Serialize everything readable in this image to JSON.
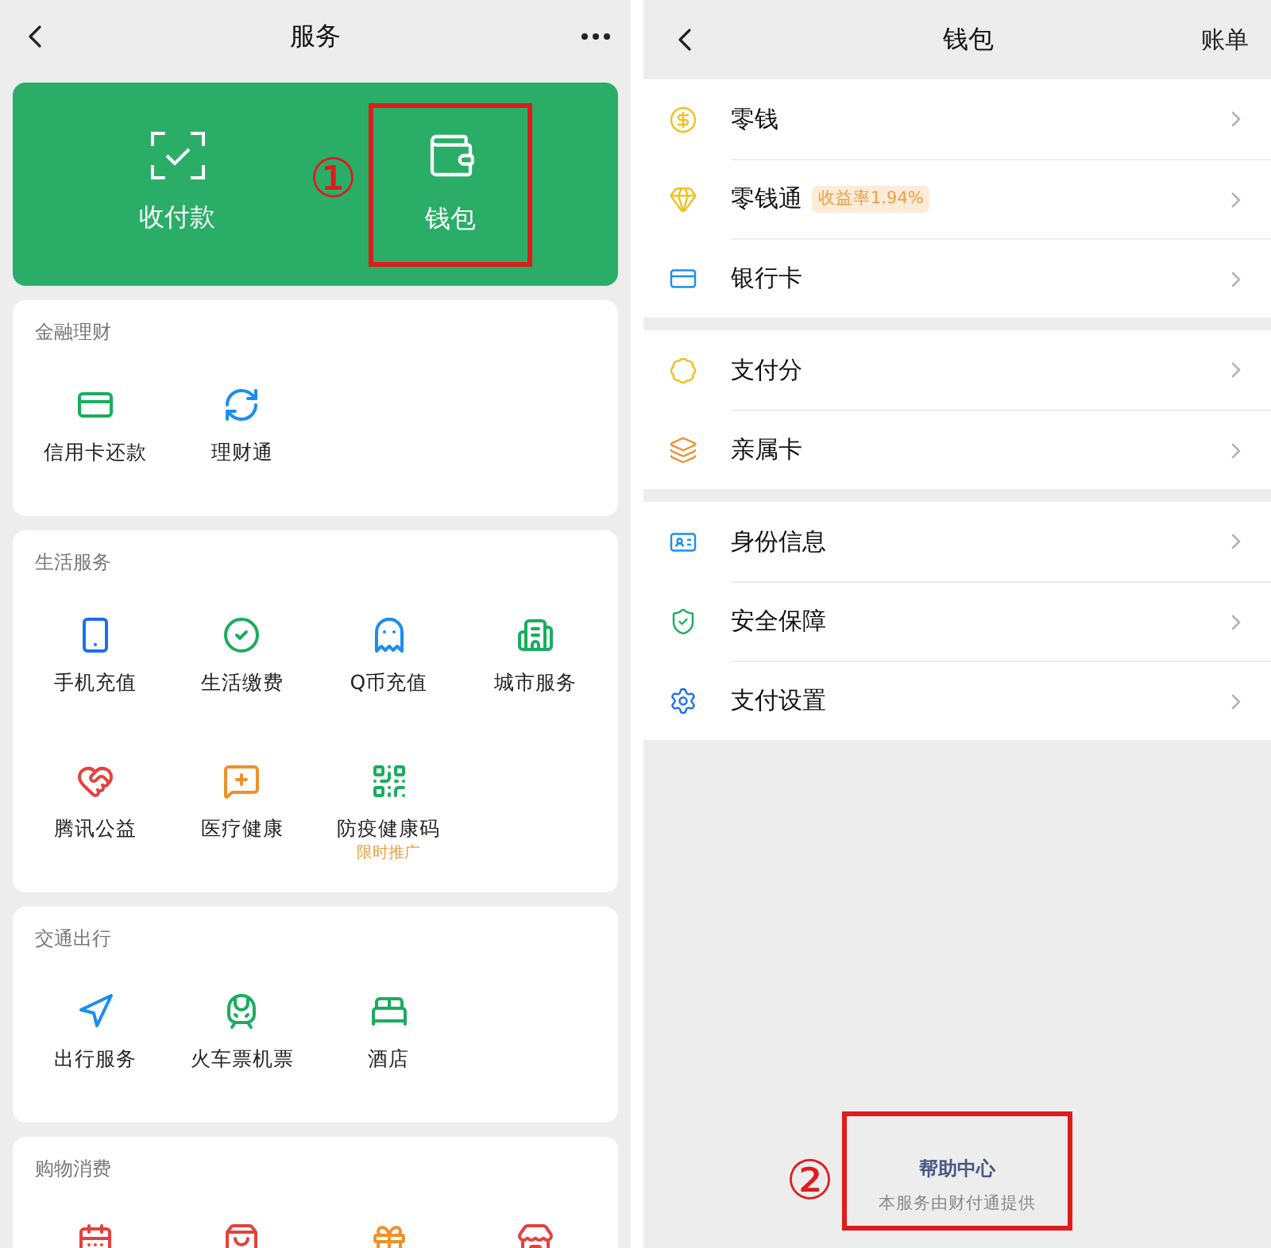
{
  "services_screen": {
    "title": "服务",
    "quick_actions": [
      {
        "label": "收付款",
        "highlighted": false
      },
      {
        "label": "钱包",
        "highlighted": true,
        "callout": "①"
      }
    ],
    "sections": [
      {
        "title": "金融理财",
        "items": [
          {
            "label": "信用卡还款"
          },
          {
            "label": "理财通"
          }
        ]
      },
      {
        "title": "生活服务",
        "items": [
          {
            "label": "手机充值"
          },
          {
            "label": "生活缴费"
          },
          {
            "label": "Q币充值"
          },
          {
            "label": "城市服务"
          },
          {
            "label": "腾讯公益"
          },
          {
            "label": "医疗健康"
          },
          {
            "label": "防疫健康码",
            "note": "限时推广"
          }
        ]
      },
      {
        "title": "交通出行",
        "items": [
          {
            "label": "出行服务"
          },
          {
            "label": "火车票机票"
          },
          {
            "label": "酒店"
          }
        ]
      },
      {
        "title": "购物消费"
      }
    ]
  },
  "wallet_screen": {
    "title": "钱包",
    "action": "账单",
    "groups": [
      {
        "items": [
          {
            "label": "零钱"
          },
          {
            "label": "零钱通",
            "badge": "收益率1.94%"
          },
          {
            "label": "银行卡"
          }
        ]
      },
      {
        "items": [
          {
            "label": "支付分"
          },
          {
            "label": "亲属卡"
          }
        ]
      },
      {
        "items": [
          {
            "label": "身份信息"
          },
          {
            "label": "安全保障"
          },
          {
            "label": "支付设置"
          }
        ]
      }
    ],
    "footer": {
      "link": "帮助中心",
      "provider": "本服务由财付通提供",
      "highlighted": true,
      "callout": "②"
    }
  }
}
